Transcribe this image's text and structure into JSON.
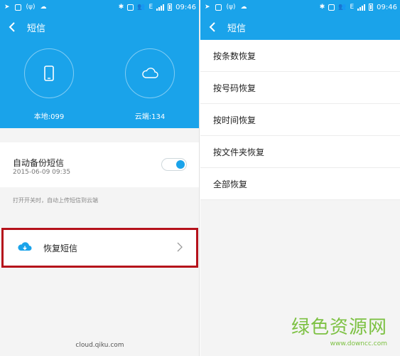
{
  "status_bar": {
    "time": "09:46",
    "network_small": "(ψ)",
    "data_label": "E"
  },
  "left": {
    "app_bar_title": "短信",
    "local_label": "本地:099",
    "cloud_label": "云端:134",
    "auto_backup": {
      "title": "自动备份短信",
      "time": "2015-06-09 09:35",
      "enabled": true
    },
    "hint": "打开开关时，自动上传短信到云端",
    "restore_label": "恢复短信",
    "footer": "cloud.qiku.com"
  },
  "right": {
    "app_bar_title": "短信",
    "menu_items": [
      "按条数恢复",
      "按号码恢复",
      "按时间恢复",
      "按文件夹恢复",
      "全部恢复"
    ]
  },
  "watermark": {
    "title": "绿色资源网",
    "url": "www.downcc.com"
  },
  "colors": {
    "accent": "#1aa3ea",
    "highlight_border": "#b5121b",
    "watermark": "#7dc143"
  }
}
